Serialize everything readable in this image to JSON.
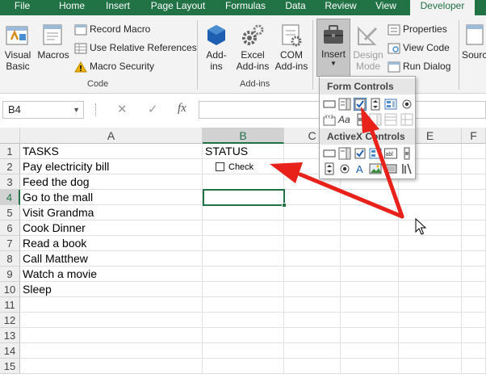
{
  "tabs": [
    "File",
    "Home",
    "Insert",
    "Page Layout",
    "Formulas",
    "Data",
    "Review",
    "View",
    "Developer"
  ],
  "ribbon": {
    "code_group": {
      "visual_basic": "Visual Basic",
      "macros": "Macros",
      "record_macro": "Record Macro",
      "use_relative": "Use Relative References",
      "macro_security": "Macro Security",
      "label": "Code"
    },
    "addins_group": {
      "addins": "Add-ins",
      "excel_addins": "Excel Add-ins",
      "com_addins": "COM Add-ins",
      "label": "Add-ins"
    },
    "controls_group": {
      "insert": "Insert",
      "design_mode": "Design Mode",
      "properties": "Properties",
      "view_code": "View Code",
      "run_dialog": "Run Dialog"
    },
    "source": "Sourc"
  },
  "formula_bar": {
    "name_box": "B4",
    "cancel": "✕",
    "enter": "✓",
    "fx": "fx"
  },
  "dropdown": {
    "form_controls": "Form Controls",
    "activex_controls": "ActiveX Controls",
    "aa": "Aa"
  },
  "sheet": {
    "columns": [
      "A",
      "B",
      "C",
      "D",
      "E",
      "F"
    ],
    "rows": [
      "1",
      "2",
      "3",
      "4",
      "5",
      "6",
      "7",
      "8",
      "9",
      "10",
      "11",
      "12",
      "13",
      "14",
      "15"
    ],
    "colA": [
      "TASKS",
      "Pay electricity bill",
      "Feed the dog",
      "Go to the mall",
      "Visit Grandma",
      "Cook Dinner",
      "Read a book",
      "Call Matthew",
      "Watch a movie",
      "Sleep",
      "",
      "",
      "",
      "",
      ""
    ],
    "colB_header": "STATUS",
    "checkbox_label": "Check"
  },
  "colors": {
    "accent": "#217346",
    "arrow": "#e8221b"
  }
}
